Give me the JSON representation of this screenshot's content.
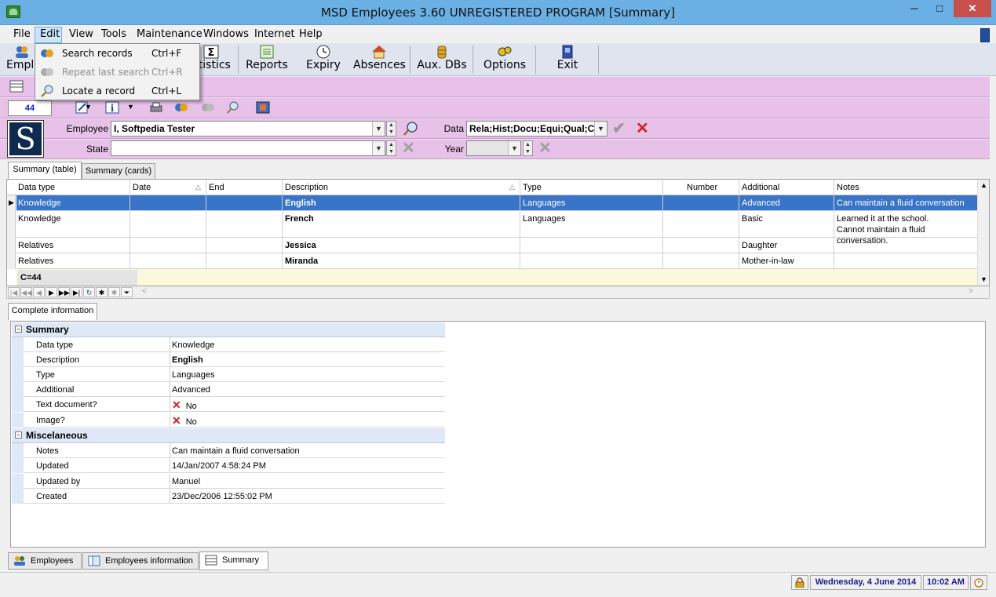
{
  "window": {
    "title": "MSD Employees 3.60 UNREGISTERED PROGRAM [Summary]",
    "minimize": "─",
    "maximize": "□",
    "close": "✕"
  },
  "menubar": [
    "File",
    "Edit",
    "View",
    "Tools",
    "Maintenance",
    "Windows",
    "Internet",
    "Help"
  ],
  "toolbar": {
    "employees": "Emplo",
    "statistics": "atistics",
    "reports": "Reports",
    "expiry": "Expiry",
    "absences": "Absences",
    "aux_dbs": "Aux. DBs",
    "options": "Options",
    "exit": "Exit"
  },
  "edit_menu": {
    "items": [
      {
        "label": "Search records",
        "shortcut": "Ctrl+F",
        "enabled": true
      },
      {
        "label": "Repeat last search",
        "shortcut": "Ctrl+R",
        "enabled": false
      },
      {
        "label": "Locate a record",
        "shortcut": "Ctrl+L",
        "enabled": true
      }
    ]
  },
  "record_count": "44",
  "logo_letter": "S",
  "filters": {
    "employee_label": "Employee",
    "employee_value": "I, Softpedia Tester",
    "data_label": "Data",
    "data_value": "Rela;Hist;Docu;Equi;Qual;Cour",
    "state_label": "State",
    "state_value": "",
    "year_label": "Year",
    "year_value": ""
  },
  "tabs": [
    "Summary (table)",
    "Summary (cards)"
  ],
  "grid": {
    "columns": [
      "Data type",
      "Date",
      "End",
      "Description",
      "Type",
      "Number",
      "Additional",
      "Notes"
    ],
    "rows": [
      {
        "data_type": "Knowledge",
        "date": "",
        "end": "",
        "description": "English",
        "type": "Languages",
        "number": "",
        "additional": "Advanced",
        "notes": "Can maintain a fluid conversation",
        "selected": true
      },
      {
        "data_type": "Knowledge",
        "date": "",
        "end": "",
        "description": "French",
        "type": "Languages",
        "number": "",
        "additional": "Basic",
        "notes": "Learned it at the school.\nCannot maintain a fluid conversation.",
        "selected": false
      },
      {
        "data_type": "Relatives",
        "date": "",
        "end": "",
        "description": "Jessica",
        "type": "",
        "number": "",
        "additional": "Daughter",
        "notes": "",
        "selected": false
      },
      {
        "data_type": "Relatives",
        "date": "",
        "end": "",
        "description": "Miranda",
        "type": "",
        "number": "",
        "additional": "Mother-in-law",
        "notes": "",
        "selected": false
      }
    ],
    "footer": "C=44"
  },
  "detail": {
    "tab": "Complete information",
    "summary_group": "Summary",
    "summary": [
      {
        "key": "Data type",
        "value": "Knowledge",
        "bold": false
      },
      {
        "key": "Description",
        "value": "English",
        "bold": true
      },
      {
        "key": "Type",
        "value": "Languages",
        "bold": false
      },
      {
        "key": "Additional",
        "value": "Advanced",
        "bold": false
      },
      {
        "key": "Text document?",
        "value": "No",
        "bold": false,
        "check": true
      },
      {
        "key": "Image?",
        "value": "No",
        "bold": false,
        "check": true
      }
    ],
    "misc_group": "Miscelaneous",
    "misc": [
      {
        "key": "Notes",
        "value": "Can maintain a fluid conversation"
      },
      {
        "key": "Updated",
        "value": "14/Jan/2007 4:58:24 PM"
      },
      {
        "key": "Updated by",
        "value": "Manuel"
      },
      {
        "key": "Created",
        "value": "23/Dec/2006 12:55:02 PM"
      }
    ]
  },
  "bottom_tabs": [
    "Employees",
    "Employees information",
    "Summary"
  ],
  "status": {
    "date": "Wednesday, 4 June 2014",
    "time": "10:02 AM"
  },
  "colors": {
    "titlebar": "#6ab0e5",
    "pink": "#e7c1e8",
    "selection": "#3874c8",
    "footer": "#fbf8dc"
  }
}
